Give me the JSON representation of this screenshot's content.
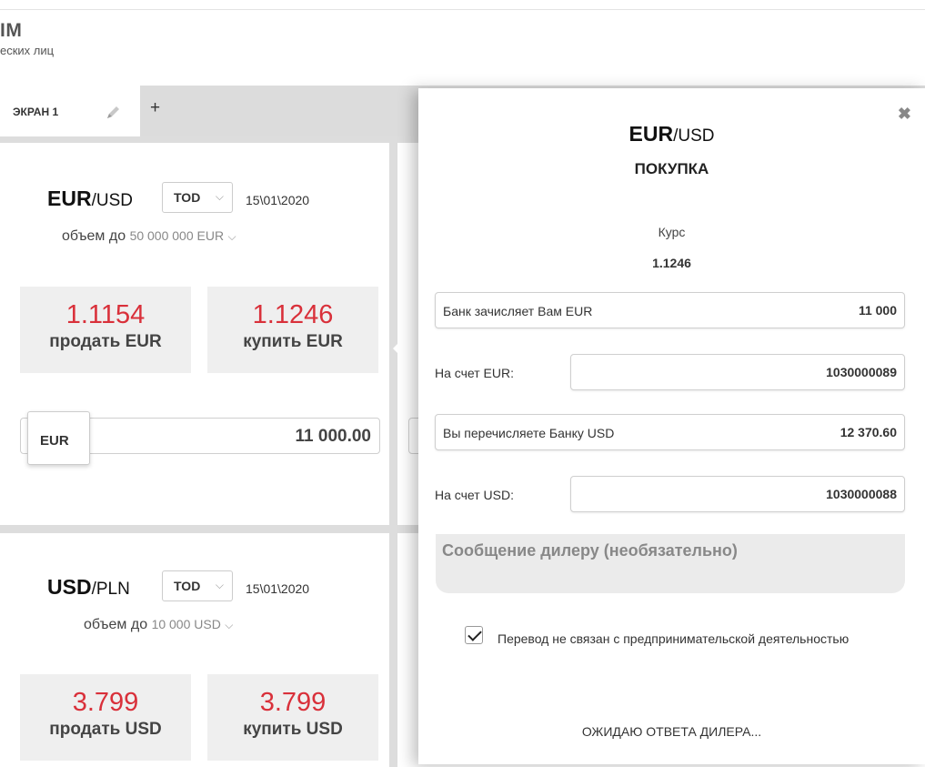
{
  "header": {
    "title": "IM",
    "subtitle": "еских лиц"
  },
  "tabs": [
    {
      "label": "ЭКРАН 1"
    }
  ],
  "add_tab_label": "+",
  "panels": [
    {
      "pair_base": "EUR",
      "pair_quote": "/USD",
      "tenor": "TOD",
      "date": "15\\01\\2020",
      "volume_prefix": "объем до",
      "volume_value": "50 000 000 EUR",
      "sell_rate": "1.1154",
      "sell_label": "продать EUR",
      "buy_rate": "1.1246",
      "buy_label": "купить EUR",
      "currency_tag": "EUR",
      "amount": "11 000.00"
    },
    {
      "pair_base": "USD",
      "pair_quote": "/PLN",
      "tenor": "TOD",
      "date": "15\\01\\2020",
      "volume_prefix": "объем до",
      "volume_value": "10 000 USD",
      "sell_rate": "3.799",
      "sell_label": "продать USD",
      "buy_rate": "3.799",
      "buy_label": "купить USD"
    }
  ],
  "modal": {
    "pair_base": "EUR",
    "pair_quote": "/USD",
    "operation": "ПОКУПКА",
    "rate_label": "Курс",
    "rate_value": "1.1246",
    "credit_label": "Банк зачисляет Вам EUR",
    "credit_value": "11 000",
    "account_eur_label": "На счет EUR:",
    "account_eur_value": "1030000089",
    "debit_label": "Вы перечисляете Банку USD",
    "debit_value": "12 370.60",
    "account_usd_label": "На счет USD:",
    "account_usd_value": "1030000088",
    "message_placeholder": "Сообщение дилеру (необязательно)",
    "checkbox_label": "Перевод не связан с предпринимательской деятельностью",
    "checkbox_checked": true,
    "status": "ОЖИДАЮ ОТВЕТА ДИЛЕРА...",
    "close_symbol": "✖"
  },
  "icons": {
    "edit": "pencil-icon",
    "close": "close-icon",
    "dropdown": "chevron-down-icon"
  },
  "colors": {
    "rate_red": "#d9303a",
    "quote_bg": "#efefef",
    "workspace_bg": "#dddddd"
  }
}
